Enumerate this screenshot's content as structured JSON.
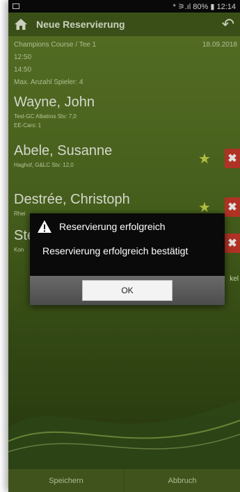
{
  "status_bar": {
    "right": "* ⚞.ıl 80% ▮ 12:14"
  },
  "action_bar": {
    "title": "Neue Reservierung"
  },
  "info": {
    "course": "Champions Course / Tee 1",
    "date": "18.09.2018",
    "time_1": "12:50",
    "time_2": "14:50",
    "max_players": "Max. Anzahl Spieler: 4"
  },
  "players": [
    {
      "name": "Wayne, John",
      "sub1": "Test-GC Albatros Stv: 7,0",
      "sub2": "EE-Cars: 1"
    },
    {
      "name": "Abele, Susanne",
      "sub1": "Haghof, G&LC Stv: 12,0"
    },
    {
      "name": "Destrée, Christoph",
      "sub1": "Rhei"
    },
    {
      "name": "Ste",
      "sub1": "Kon"
    }
  ],
  "edge_text": "kel",
  "dialog": {
    "title": "Reservierung erfolgreich",
    "message": "Reservierung erfolgreich bestätigt",
    "ok_label": "OK"
  },
  "bottom_bar": {
    "save_label": "Speichern",
    "cancel_label": "Abbruch"
  }
}
